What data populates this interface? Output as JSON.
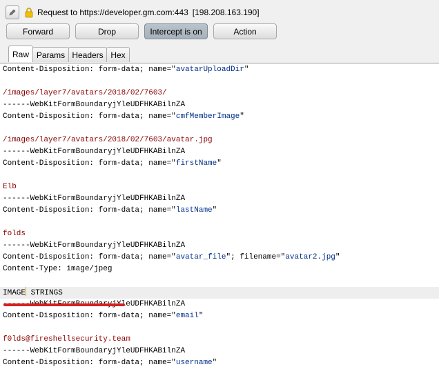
{
  "request": {
    "title": "Request to https://developer.gm.com:443",
    "ip": "[198.208.163.190]"
  },
  "buttons": {
    "forward": "Forward",
    "drop": "Drop",
    "intercept": "Intercept is on",
    "action": "Action"
  },
  "tabs": [
    "Raw",
    "Params",
    "Headers",
    "Hex"
  ],
  "body_lines": [
    {
      "pre": "Content-Disposition: form-data; name=\"",
      "val": "avatarUploadDir",
      "post": "\""
    },
    {
      "plain": ""
    },
    {
      "red": "/images/layer7/avatars/2018/02/7603/"
    },
    {
      "plain": "------WebKitFormBoundaryjYleUDFHKABilnZA"
    },
    {
      "pre": "Content-Disposition: form-data; name=\"",
      "val": "cmfMemberImage",
      "post": "\""
    },
    {
      "plain": ""
    },
    {
      "red": "/images/layer7/avatars/2018/02/7603/avatar.jpg"
    },
    {
      "plain": "------WebKitFormBoundaryjYleUDFHKABilnZA"
    },
    {
      "pre": "Content-Disposition: form-data; name=\"",
      "val": "firstName",
      "post": "\""
    },
    {
      "plain": ""
    },
    {
      "red": "Elb"
    },
    {
      "plain": "------WebKitFormBoundaryjYleUDFHKABilnZA"
    },
    {
      "pre": "Content-Disposition: form-data; name=\"",
      "val": "lastName",
      "post": "\""
    },
    {
      "plain": ""
    },
    {
      "red": "folds"
    },
    {
      "plain": "------WebKitFormBoundaryjYleUDFHKABilnZA"
    },
    {
      "pre": "Content-Disposition: form-data; name=\"",
      "val": "avatar_file",
      "mid": "\"; filename=\"",
      "val2": "avatar2.jpg",
      "post": "\""
    },
    {
      "plain": "Content-Type: image/jpeg"
    },
    {
      "plain": ""
    },
    {
      "caret_pre": "IMAGE",
      "caret_post": " STRINGS",
      "highlight": true
    },
    {
      "plain": "------WebKitFormBoundaryjYleUDFHKABilnZA"
    },
    {
      "pre": "Content-Disposition: form-data; name=\"",
      "val": "email",
      "post": "\""
    },
    {
      "plain": ""
    },
    {
      "red": "f0lds@fireshellsecurity.team"
    },
    {
      "plain": "------WebKitFormBoundaryjYleUDFHKABilnZA"
    },
    {
      "pre": "Content-Disposition: form-data; name=\"",
      "val": "username",
      "post": "\""
    }
  ]
}
